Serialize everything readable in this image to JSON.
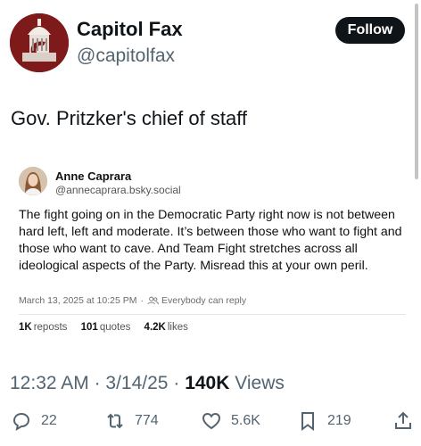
{
  "header": {
    "display_name": "Capitol Fax",
    "handle": "@capitolfax",
    "follow_label": "Follow"
  },
  "tweet": {
    "text": "Gov. Pritzker's chief of staff"
  },
  "quoted_post": {
    "author_name": "Anne Caprara",
    "author_handle": "@annecaprara.bsky.social",
    "body": "The fight going on in the Democratic Party right now is not between hard left, left and moderate.  It’s between those who want to fight and those who want to cave. And Team Fight stretches across all ideological aspects of the Party. Misread this at your own peril.",
    "timestamp": "March 13, 2025 at 10:25 PM",
    "reply_setting": "Everybody can reply",
    "reposts_count": "1K",
    "reposts_label": "reposts",
    "quotes_count": "101",
    "quotes_label": "quotes",
    "likes_count": "4.2K",
    "likes_label": "likes"
  },
  "post_meta": {
    "time": "12:32 AM",
    "date": "3/14/25",
    "views_count": "140K",
    "views_label": "Views"
  },
  "actions": {
    "replies": "22",
    "reposts": "774",
    "likes": "5.6K",
    "bookmarks": "219"
  },
  "colors": {
    "text_primary": "#0f1419",
    "text_secondary": "#536471",
    "follow_bg": "#0f1419",
    "avatar_bg": "#7e1a1a"
  }
}
